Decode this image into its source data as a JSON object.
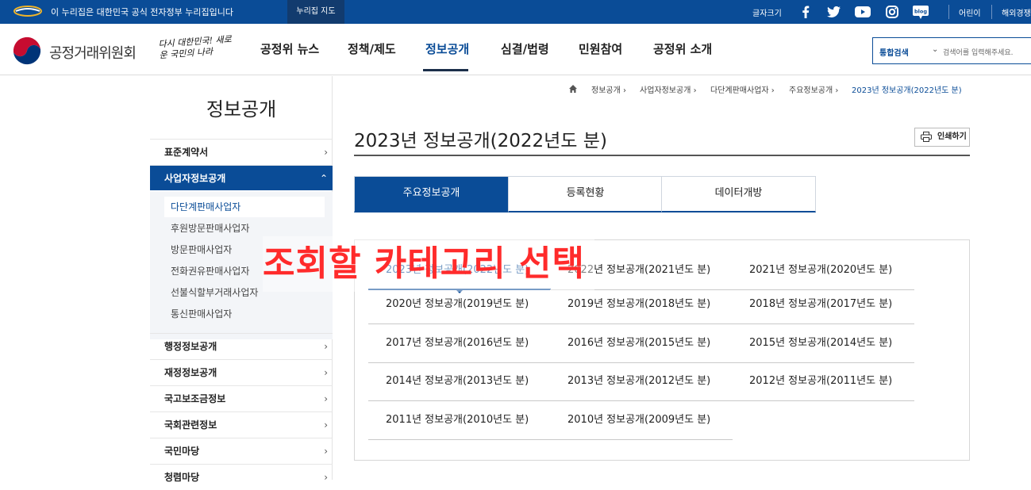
{
  "gov_bar": {
    "notice": "이 누리집은 대한민국 공식 전자정부 누리집입니다",
    "sitemap": "누리집 지도",
    "font_size": "글자크기",
    "social": [
      "facebook-icon",
      "twitter-icon",
      "youtube-icon",
      "instagram-icon",
      "blog-icon"
    ],
    "kids": "어린이",
    "intl": "해외경쟁"
  },
  "header": {
    "org_name": "공정거래위원회",
    "slogan": "다시 대한민국! 새로운 국민의 나라",
    "nav": [
      "공정위 뉴스",
      "정책/제도",
      "정보공개",
      "심결/법령",
      "민원참여",
      "공정위 소개"
    ],
    "nav_active_index": 2,
    "search_scope": "통합검색",
    "search_placeholder": "검색어를 입력해주세요."
  },
  "sidebar": {
    "title": "정보공개",
    "items": [
      "표준계약서",
      "사업자정보공개",
      "행정정보공개",
      "재정정보공개",
      "국고보조금정보",
      "국회관련정보",
      "국민마당",
      "청렴마당"
    ],
    "open_index": 1,
    "subitems": [
      "다단계판매사업자",
      "후원방문판매사업자",
      "방문판매사업자",
      "전화권유판매사업자",
      "선불식할부거래사업자",
      "통신판매사업자"
    ],
    "selected_sub": 0
  },
  "breadcrumb": [
    "정보공개",
    "사업자정보공개",
    "다단계판매사업자",
    "주요정보공개",
    "2023년 정보공개(2022년도 분)"
  ],
  "content": {
    "title": "2023년 정보공개(2022년도 분)",
    "print": "인쇄하기",
    "tabs": [
      "주요정보공개",
      "등록현황",
      "데이터개방"
    ],
    "active_tab": 0,
    "years": [
      "2023년 정보공개(2022년도 분)",
      "2022년 정보공개(2021년도 분)",
      "2021년 정보공개(2020년도 분)",
      "2020년 정보공개(2019년도 분)",
      "2019년 정보공개(2018년도 분)",
      "2018년 정보공개(2017년도 분)",
      "2017년 정보공개(2016년도 분)",
      "2016년 정보공개(2015년도 분)",
      "2015년 정보공개(2014년도 분)",
      "2014년 정보공개(2013년도 분)",
      "2013년 정보공개(2012년도 분)",
      "2012년 정보공개(2011년도 분)",
      "2011년 정보공개(2010년도 분)",
      "2010년 정보공개(2009년도 분)"
    ],
    "selected_year": 0
  },
  "annotation": "조회할 카테고리 선택",
  "colors": {
    "brand": "#0a4c97",
    "annotation": "#ff2b2b"
  }
}
